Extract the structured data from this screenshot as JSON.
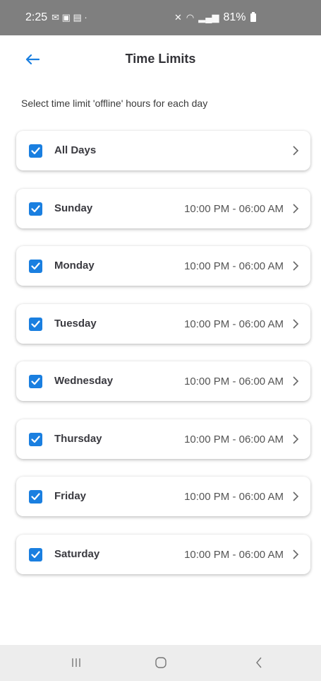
{
  "status_bar": {
    "time": "2:25",
    "battery": "81%"
  },
  "header": {
    "title": "Time Limits"
  },
  "subtitle": "Select time limit 'offline' hours for each day",
  "days": [
    {
      "label": "All Days",
      "time": "",
      "checked": true
    },
    {
      "label": "Sunday",
      "time": "10:00 PM - 06:00 AM",
      "checked": true
    },
    {
      "label": "Monday",
      "time": "10:00 PM - 06:00 AM",
      "checked": true
    },
    {
      "label": "Tuesday",
      "time": "10:00 PM - 06:00 AM",
      "checked": true
    },
    {
      "label": "Wednesday",
      "time": "10:00 PM - 06:00 AM",
      "checked": true
    },
    {
      "label": "Thursday",
      "time": "10:00 PM - 06:00 AM",
      "checked": true
    },
    {
      "label": "Friday",
      "time": "10:00 PM - 06:00 AM",
      "checked": true
    },
    {
      "label": "Saturday",
      "time": "10:00 PM - 06:00 AM",
      "checked": true
    }
  ],
  "colors": {
    "accent": "#1a7fe0",
    "status_bar": "#7f7f7f",
    "nav_bar": "#ededed"
  },
  "icons": {
    "back": "arrow-left-icon",
    "checkbox": "checkbox-checked-icon",
    "chevron": "chevron-right-icon",
    "nav_recents": "recents-icon",
    "nav_home": "home-icon",
    "nav_back": "back-icon"
  }
}
